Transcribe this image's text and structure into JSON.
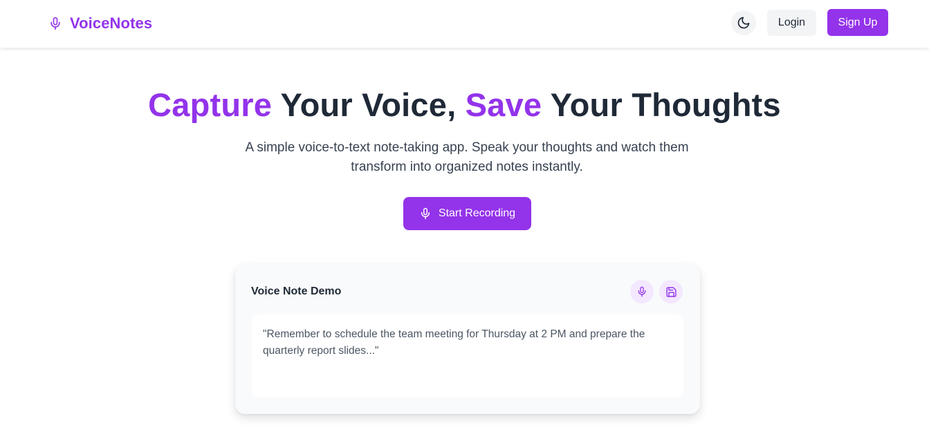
{
  "brand": {
    "name": "VoiceNotes",
    "icon": "microphone-icon"
  },
  "nav": {
    "theme_toggle_icon": "moon-icon",
    "login_label": "Login",
    "signup_label": "Sign Up"
  },
  "hero": {
    "title_parts": [
      "Capture",
      " Your Voice, ",
      "Save",
      " Your Thoughts"
    ],
    "subtitle": "A simple voice-to-text note-taking app. Speak your thoughts and watch them transform into organized notes instantly.",
    "record_label": "Start Recording",
    "record_icon": "microphone-icon"
  },
  "demo": {
    "title": "Voice Note Demo",
    "mic_icon": "microphone-icon",
    "save_icon": "save-icon",
    "transcript": "\"Remember to schedule the team meeting for Thursday at 2 PM and prepare the quarterly report slides...\""
  },
  "colors": {
    "accent": "#9333ea",
    "accent_light": "#f3e8ff",
    "text_dark": "#1f2937",
    "button_gray": "#f3f4f6"
  }
}
